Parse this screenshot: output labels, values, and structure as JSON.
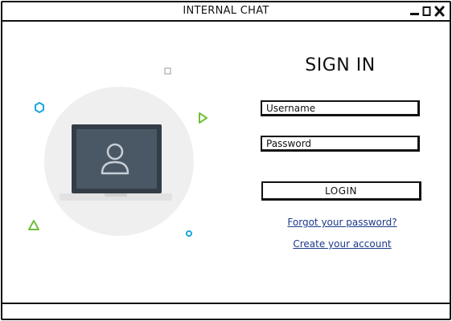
{
  "window": {
    "title": "INTERNAL CHAT",
    "controls": [
      "minimize-icon",
      "maximize-icon",
      "close-icon"
    ]
  },
  "signin": {
    "heading": "SIGN IN",
    "username_placeholder": "Username",
    "password_placeholder": "Password",
    "login_label": "LOGIN",
    "forgot_link": "Forgot your password?",
    "create_link": "Create your account"
  },
  "illustration": {
    "icon": "laptop-user-icon",
    "colors": {
      "circle": "#efefef",
      "laptop_frame": "#333d47",
      "screen": "#4a5865",
      "user_glyph": "#c7ced6",
      "accent_blue": "#1aa7e0",
      "accent_green": "#6fbf3a"
    }
  }
}
